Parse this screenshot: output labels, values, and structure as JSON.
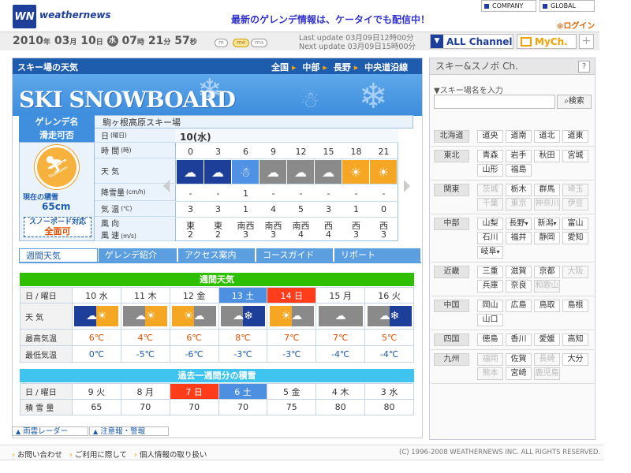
{
  "header": {
    "logo_text": "WN",
    "brand": "weathernews",
    "promo": "最新のゲレンデ情報は、ケータイでも配信中！",
    "company": "COMPANY",
    "global": "GLOBAL",
    "login": "ログイン"
  },
  "subbar": {
    "year": "2010",
    "y_unit": "年",
    "month": "03",
    "m_unit": "月",
    "day": "10",
    "d_unit": "日",
    "dow": "水",
    "hour": "07",
    "h_unit": "時",
    "minute": "21",
    "min_unit": "分",
    "second": "57",
    "s_unit": "秒",
    "sizes": [
      "m",
      "me",
      "ma"
    ],
    "last_update": "Last update  03月09日12時00分",
    "next_update": "Next update  03月09日15時00分",
    "all_channel": "ALL Channel",
    "my_ch": "MyCh.",
    "plus": "+"
  },
  "main": {
    "title": "スキー場の天気",
    "regions": [
      "全国",
      "中部",
      "長野",
      "中央道沿線"
    ],
    "banner_text": "SKI SNOWBOARD",
    "resort_label": "ゲレンデ名",
    "resort_name": "駒ヶ根高原スキー場",
    "status_label": "滑走可否",
    "snow_label": "現在の積雪",
    "snow_value": "65cm",
    "snowboard_label": "スノーボード対応",
    "snowboard_value": "全面可",
    "row_labels": {
      "date": "日",
      "date_sub": "(曜日)",
      "time": "時 間",
      "time_sub": "(時)",
      "weather": "天 気",
      "precip": "降雪量",
      "precip_sub": "(cm/h)",
      "temp": "気 温",
      "temp_sub": "(℃)",
      "wind_dir": "風 向",
      "wind_speed": "風 速",
      "wind_speed_sub": "(m/s)"
    },
    "daily_date": "10(水)",
    "hours": [
      "0",
      "3",
      "6",
      "9",
      "12",
      "15",
      "18",
      "21"
    ],
    "daily_weather_icons": [
      "snow-night-icon",
      "snow-night-icon",
      "snowman-icon",
      "cloud-icon",
      "cloud-icon",
      "cloud-icon",
      "sun-icon",
      "sun-icon"
    ],
    "precip": [
      "-",
      "-",
      "1",
      "-",
      "-",
      "-",
      "-",
      "-"
    ],
    "temp": [
      "3",
      "3",
      "1",
      "4",
      "5",
      "3",
      "1",
      "0"
    ],
    "wind_dir": [
      "東",
      "東",
      "南西",
      "南西",
      "南西",
      "西",
      "西",
      "西"
    ],
    "wind_speed": [
      "2",
      "2",
      "3",
      "3",
      "4",
      "4",
      "3",
      "3"
    ],
    "tabs": [
      "週間天気",
      "ゲレンデ紹介",
      "アクセス案内",
      "コースガイド",
      "リポート"
    ],
    "weekly": {
      "title": "週間天気",
      "header_label": "日 / 曜日",
      "weather_label": "天 気",
      "high_label": "最高気温",
      "low_label": "最低気温",
      "days": [
        "10 水",
        "11 木",
        "12 金",
        "13 土",
        "14 日",
        "15 月",
        "16 火"
      ],
      "icons": [
        "snow-sun-icon",
        "cloud-sun-icon",
        "sun-cloud-icon",
        "cloud-snow-icon",
        "sun-cloud-icon",
        "cloud-icon",
        "cloud-snow-icon"
      ],
      "high": [
        "6℃",
        "4℃",
        "6℃",
        "8℃",
        "7℃",
        "7℃",
        "5℃"
      ],
      "low": [
        "0℃",
        "-5℃",
        "-6℃",
        "-3℃",
        "-3℃",
        "-4℃",
        "-4℃"
      ]
    },
    "past": {
      "title": "過去一週間分の積雪",
      "header_label": "日 / 曜日",
      "row_label": "積 雪 量",
      "days": [
        "9 火",
        "8 月",
        "7 日",
        "6 土",
        "5 金",
        "4 木",
        "3 水"
      ],
      "values": [
        "65",
        "70",
        "70",
        "70",
        "75",
        "80",
        "80"
      ]
    },
    "links": [
      "雨雲レーダー",
      "注意報・警報"
    ]
  },
  "right": {
    "title": "スキー&スノボ Ch.",
    "help": "?",
    "search_label": "▼スキー場名を入力",
    "search_placeholder": "",
    "search_button": "検索",
    "regions": [
      {
        "name": "北海道",
        "prefs": [
          {
            "n": "道央",
            "e": 1
          },
          {
            "n": "道南",
            "e": 1
          },
          {
            "n": "道北",
            "e": 1
          },
          {
            "n": "道東",
            "e": 1
          }
        ]
      },
      {
        "name": "東北",
        "prefs": [
          {
            "n": "青森",
            "e": 1
          },
          {
            "n": "岩手",
            "e": 1
          },
          {
            "n": "秋田",
            "e": 1
          },
          {
            "n": "宮城",
            "e": 1
          },
          {
            "n": "山形",
            "e": 1
          },
          {
            "n": "福島",
            "e": 1
          }
        ]
      },
      {
        "name": "関東",
        "prefs": [
          {
            "n": "茨城",
            "e": 0
          },
          {
            "n": "栃木",
            "e": 1
          },
          {
            "n": "群馬",
            "e": 1
          },
          {
            "n": "埼玉",
            "e": 0
          },
          {
            "n": "千葉",
            "e": 0
          },
          {
            "n": "東京",
            "e": 0
          },
          {
            "n": "神奈川",
            "e": 0
          },
          {
            "n": "伊豆",
            "e": 0
          }
        ]
      },
      {
        "name": "中部",
        "prefs": [
          {
            "n": "山梨",
            "e": 1
          },
          {
            "n": "長野",
            "e": 1,
            "d": 1
          },
          {
            "n": "新潟",
            "e": 1,
            "d": 1
          },
          {
            "n": "富山",
            "e": 1
          },
          {
            "n": "石川",
            "e": 1
          },
          {
            "n": "福井",
            "e": 1
          },
          {
            "n": "静岡",
            "e": 1
          },
          {
            "n": "愛知",
            "e": 1
          },
          {
            "n": "岐阜",
            "e": 1,
            "d": 1
          }
        ]
      },
      {
        "name": "近畿",
        "prefs": [
          {
            "n": "三重",
            "e": 1
          },
          {
            "n": "滋賀",
            "e": 1
          },
          {
            "n": "京都",
            "e": 1
          },
          {
            "n": "大阪",
            "e": 0
          },
          {
            "n": "兵庫",
            "e": 1
          },
          {
            "n": "奈良",
            "e": 1
          },
          {
            "n": "和歌山",
            "e": 0
          }
        ]
      },
      {
        "name": "中国",
        "prefs": [
          {
            "n": "岡山",
            "e": 1
          },
          {
            "n": "広島",
            "e": 1
          },
          {
            "n": "鳥取",
            "e": 1
          },
          {
            "n": "島根",
            "e": 1
          },
          {
            "n": "山口",
            "e": 1
          }
        ]
      },
      {
        "name": "四国",
        "prefs": [
          {
            "n": "徳島",
            "e": 1
          },
          {
            "n": "香川",
            "e": 1
          },
          {
            "n": "愛媛",
            "e": 1
          },
          {
            "n": "高知",
            "e": 1
          }
        ]
      },
      {
        "name": "九州",
        "prefs": [
          {
            "n": "福岡",
            "e": 0
          },
          {
            "n": "佐賀",
            "e": 1
          },
          {
            "n": "長崎",
            "e": 0
          },
          {
            "n": "大分",
            "e": 1
          },
          {
            "n": "熊本",
            "e": 0
          },
          {
            "n": "宮崎",
            "e": 1
          },
          {
            "n": "鹿児島",
            "e": 0
          }
        ]
      }
    ]
  },
  "footer": {
    "links": [
      "お問い合わせ",
      "ご利用に際して",
      "個人情報の取り扱い"
    ],
    "copyright": "(C) 1996-2008 WEATHERNEWS INC. ALL RIGHTS RESERVED."
  },
  "colors": {
    "brand_blue": "#1d3f9a",
    "title_bar": "#1e5cae",
    "section_green": "#2ec000",
    "section_cyan": "#3fc3ef",
    "saturday": "#4d8fe0",
    "sunday": "#ff3d1a",
    "accent_orange": "#f0a000"
  }
}
